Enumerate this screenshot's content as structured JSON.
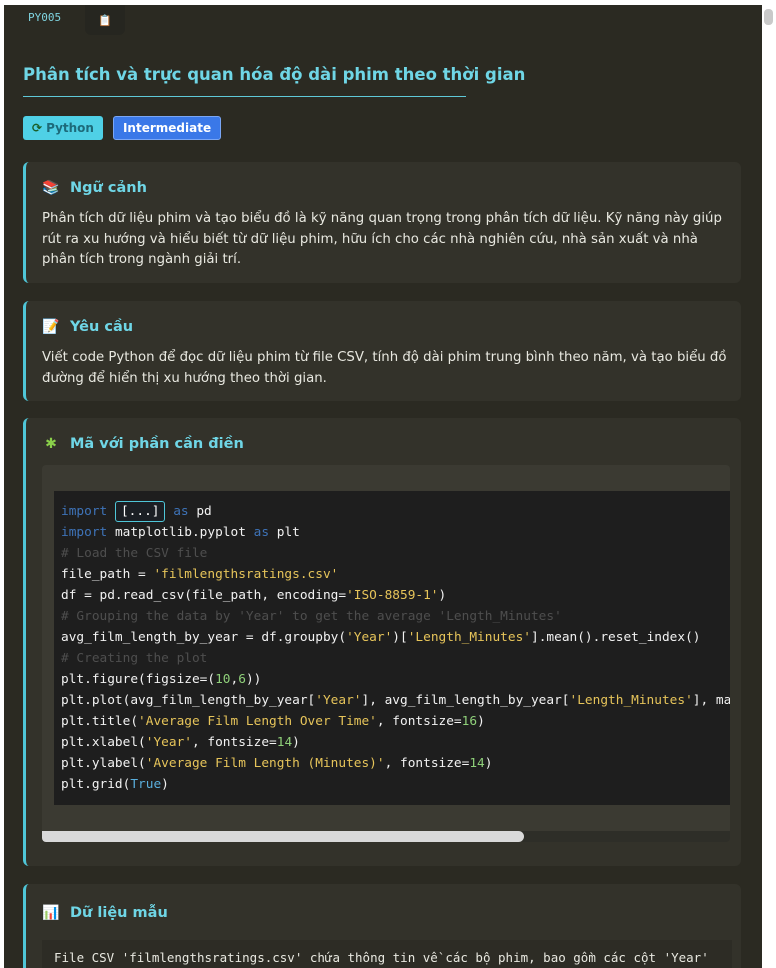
{
  "tab": {
    "id": "PY005",
    "icon": "clipboard-icon"
  },
  "title": "Phân tích và trực quan hóa độ dài phim theo thời gian",
  "badges": {
    "language": "Python",
    "level": "Intermediate"
  },
  "context": {
    "heading": "Ngữ cảnh",
    "text": "Phân tích dữ liệu phim và tạo biểu đồ là kỹ năng quan trọng trong phân tích dữ liệu. Kỹ năng này giúp rút ra xu hướng và hiểu biết từ dữ liệu phim, hữu ích cho các nhà nghiên cứu, nhà sản xuất và nhà phân tích trong ngành giải trí."
  },
  "requirement": {
    "heading": "Yêu cầu",
    "text": "Viết code Python để đọc dữ liệu phim từ file CSV, tính độ dài phim trung bình theo năm, và tạo biểu đồ đường để hiển thị xu hướng theo thời gian."
  },
  "code_section": {
    "heading": "Mã với phần cần điền",
    "blank": "[...]"
  },
  "sample": {
    "heading": "Dữ liệu mẫu",
    "text": "File CSV 'filmlengthsratings.csv' chứa thông tin về các bộ phim, bao gồm các cột 'Year'"
  },
  "colors": {
    "accent": "#4fc6d8",
    "background": "#2b2a22",
    "badge_level": "#3a78e8"
  }
}
